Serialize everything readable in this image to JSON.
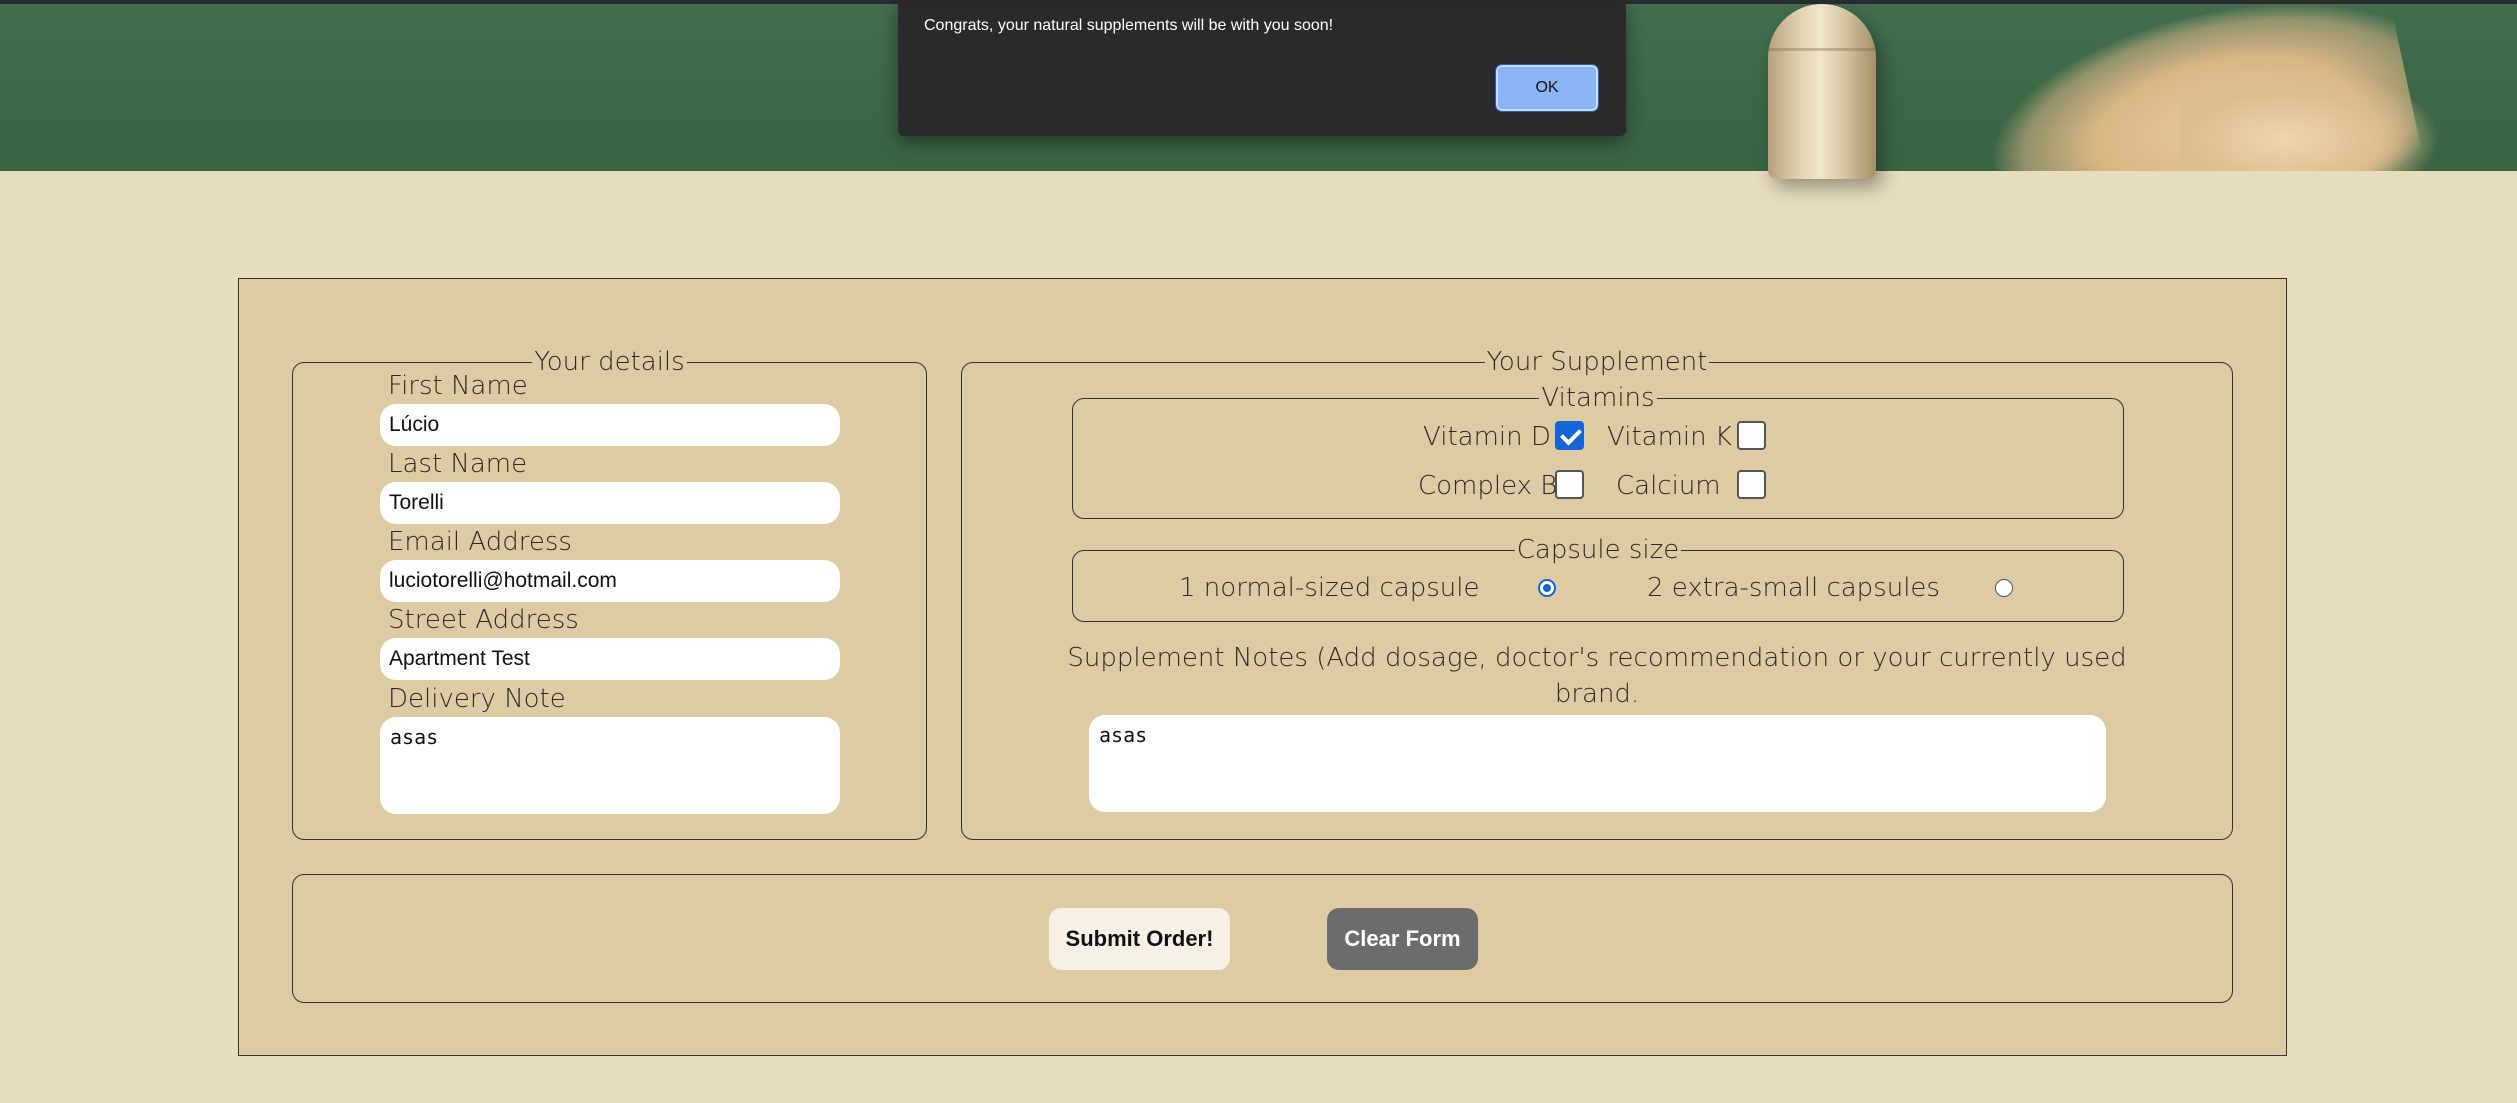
{
  "dialog": {
    "message": "Congrats, your natural supplements will be with you soon!",
    "ok_label": "OK"
  },
  "details": {
    "legend": "Your details",
    "first_name_label": "First Name",
    "first_name_value": "Lúcio",
    "last_name_label": "Last Name",
    "last_name_value": "Torelli",
    "email_label": "Email Address",
    "email_value": "luciotorelli@hotmail.com",
    "street_label": "Street Address",
    "street_value": "Apartment Test",
    "note_label": "Delivery Note",
    "note_value": "asas"
  },
  "supplement": {
    "legend": "Your Supplement",
    "vitamins": {
      "legend": "Vitamins",
      "items": [
        {
          "label": "Vitamin D",
          "checked": true
        },
        {
          "label": "Vitamin K",
          "checked": false
        },
        {
          "label": "Complex B",
          "checked": false
        },
        {
          "label": "Calcium",
          "checked": false
        }
      ]
    },
    "capsule": {
      "legend": "Capsule size",
      "options": [
        {
          "label": "1 normal-sized capsule",
          "selected": true
        },
        {
          "label": "2 extra-small capsules",
          "selected": false
        }
      ]
    },
    "notes_label_line1": "Supplement Notes (Add dosage, doctor's recommendation or your currently used",
    "notes_label_line2": "brand.",
    "notes_value": "asas"
  },
  "actions": {
    "submit_label": "Submit Order!",
    "clear_label": "Clear Form"
  },
  "colors": {
    "page_bg": "#e6dcbe",
    "form_bg": "#dccba3",
    "banner_green": "#3d6a48",
    "accent_blue": "#1565d8",
    "submit_bg": "#f6f1e4",
    "clear_bg": "#6d6c6d"
  }
}
